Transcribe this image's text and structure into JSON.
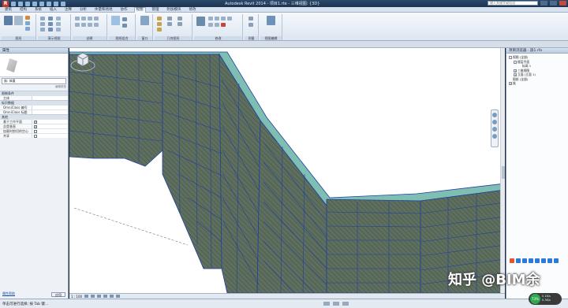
{
  "window": {
    "title": "Autodesk Revit 2014 -   项目1.rte - 三维视图: {3D}",
    "search_placeholder": "键入关键字或短语"
  },
  "tabs": [
    "建筑",
    "结构",
    "系统",
    "插入",
    "注释",
    "分析",
    "体量和场地",
    "协作",
    "视图",
    "管理",
    "附加模块",
    "修改"
  ],
  "active_tab": "视图",
  "ribbon": {
    "panels": [
      {
        "title": "图形"
      },
      {
        "title": "演示视图"
      },
      {
        "title": "创建"
      },
      {
        "title": "图纸组合"
      },
      {
        "title": "窗口"
      },
      {
        "title": "几何图形"
      },
      {
        "title": "修改"
      },
      {
        "title": "测量"
      },
      {
        "title": "视图编辑"
      }
    ],
    "labels": {
      "view_label": "视图",
      "show_label": "显示",
      "import_label": "载入到项目中"
    }
  },
  "properties": {
    "header": "属性",
    "type_select": "族: 体量",
    "edit_type": "编辑类型",
    "groups": [
      {
        "name": "限制条件",
        "rows": [
          {
            "name": "主体",
            "value": ""
          }
        ]
      },
      {
        "name": "标识数据",
        "rows": [
          {
            "name": "OmniClass 编号",
            "value": ""
          },
          {
            "name": "OmniClass 标题",
            "value": ""
          }
        ]
      },
      {
        "name": "其他",
        "rows": [
          {
            "name": "基于工作平面",
            "value": "✓"
          },
          {
            "name": "总是垂直",
            "value": "✓"
          },
          {
            "name": "加载时剪切的空心",
            "value": ""
          },
          {
            "name": "共享",
            "value": ""
          }
        ]
      }
    ],
    "help_link": "属性帮助",
    "apply_label": "应用"
  },
  "project_browser": {
    "header": "项目浏览器 - 族1.rfa",
    "items": [
      {
        "label": "视图 (全部)",
        "depth": 0,
        "toggle": "-"
      },
      {
        "label": "楼层平面",
        "depth": 1,
        "toggle": "-"
      },
      {
        "label": "标高 1",
        "depth": 2,
        "toggle": ""
      },
      {
        "label": "三维视图",
        "depth": 1,
        "toggle": "+"
      },
      {
        "label": "立面 (立面 1)",
        "depth": 1,
        "toggle": "+"
      },
      {
        "label": "图纸 (全部)",
        "depth": 0,
        "toggle": ""
      },
      {
        "label": "族",
        "depth": 0,
        "toggle": "+"
      }
    ]
  },
  "view_bar": {
    "scale": "1 : 100"
  },
  "status": {
    "text": "单击可进行选择; 按 Tab 键..."
  },
  "watermark": "知乎 @BIM余",
  "net_speed": {
    "percent": "73%",
    "up": "0.1K/s",
    "down": "0.3K/s"
  },
  "colors": {
    "wall_face": "#5f6f5f",
    "wall_edge": "#1f3f9f",
    "wall_top": "#7fbfb3"
  }
}
